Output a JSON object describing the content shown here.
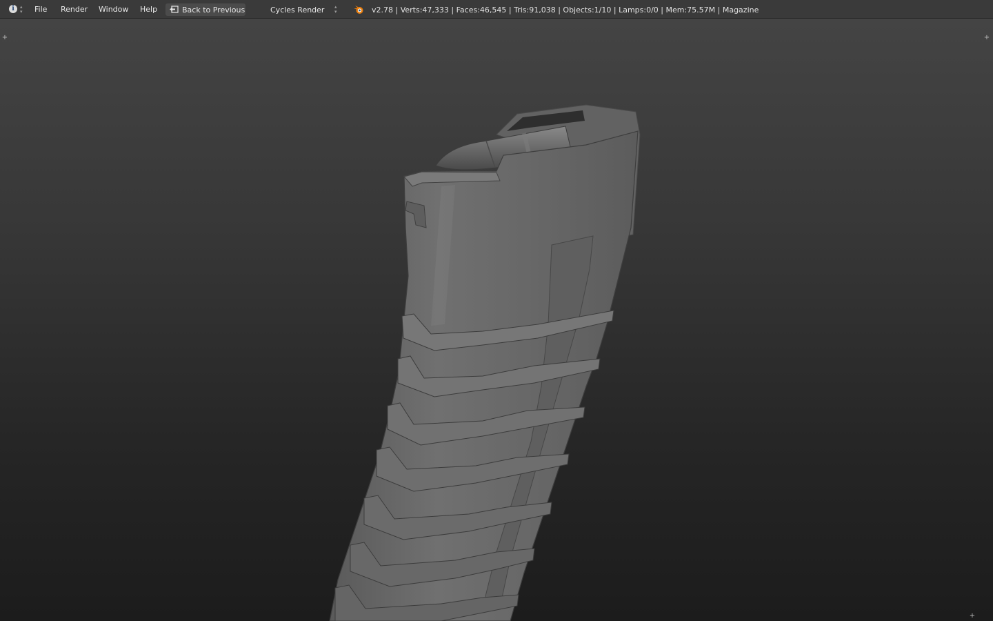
{
  "topbar": {
    "info_icon": "info-icon",
    "menu": [
      "File",
      "Render",
      "Window",
      "Help"
    ],
    "back_button": {
      "label": "Back to Previous",
      "icon": "back-arrow-icon"
    },
    "render_engine": "Cycles Render",
    "stats": "v2.78 | Verts:47,333 | Faces:46,545 | Tris:91,038 | Objects:1/10 | Lamps:0/0 | Mem:75.57M | Magazine"
  },
  "viewport": {
    "subject": "rifle-magazine-model",
    "shading": "solid-gray",
    "background_colors": [
      "#444444",
      "#1c1c1c"
    ]
  },
  "colors": {
    "header_bg": "#3a3a3a",
    "model_gray": "#6a6a6a",
    "blender_orange": "#e87d0d"
  }
}
